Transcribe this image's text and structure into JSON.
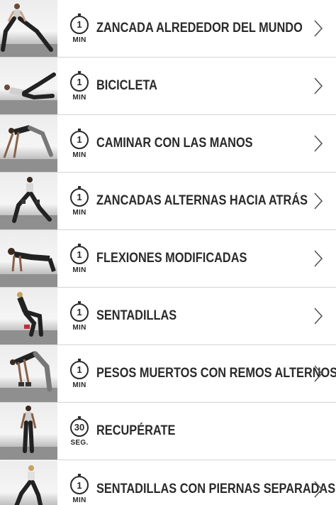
{
  "exercises": [
    {
      "title": "ZANCADA ALREDEDOR DEL MUNDO",
      "duration": "1",
      "unit": "MIN",
      "thumbnail": "lunge-around-world-photo",
      "chevron": true
    },
    {
      "title": "BICICLETA",
      "duration": "1",
      "unit": "MIN",
      "thumbnail": "bicycle-crunch-photo",
      "chevron": true
    },
    {
      "title": "CAMINAR CON LAS MANOS",
      "duration": "1",
      "unit": "MIN",
      "thumbnail": "hand-walk-photo",
      "chevron": true
    },
    {
      "title": "ZANCADAS ALTERNAS HACIA ATRÁS",
      "duration": "1",
      "unit": "MIN",
      "thumbnail": "reverse-lunge-photo",
      "chevron": true
    },
    {
      "title": "FLEXIONES MODIFICADAS",
      "duration": "1",
      "unit": "MIN",
      "thumbnail": "modified-pushup-photo",
      "chevron": true
    },
    {
      "title": "SENTADILLAS",
      "duration": "1",
      "unit": "MIN",
      "thumbnail": "squat-photo",
      "chevron": true
    },
    {
      "title": "PESOS MUERTOS CON REMOS ALTERNOS",
      "duration": "1",
      "unit": "MIN",
      "thumbnail": "deadlift-row-photo",
      "chevron": true
    },
    {
      "title": "RECUPÉRATE",
      "duration": "30",
      "unit": "SEG.",
      "thumbnail": "recover-photo",
      "chevron": false
    },
    {
      "title": "SENTADILLAS CON PIERNAS SEPARADAS",
      "duration": "1",
      "unit": "MIN",
      "thumbnail": "split-squat-photo",
      "chevron": true
    }
  ],
  "colors": {
    "text": "#2a2a2a",
    "divider": "#d4d4d4",
    "chevron": "#555555",
    "background": "#ffffff"
  }
}
